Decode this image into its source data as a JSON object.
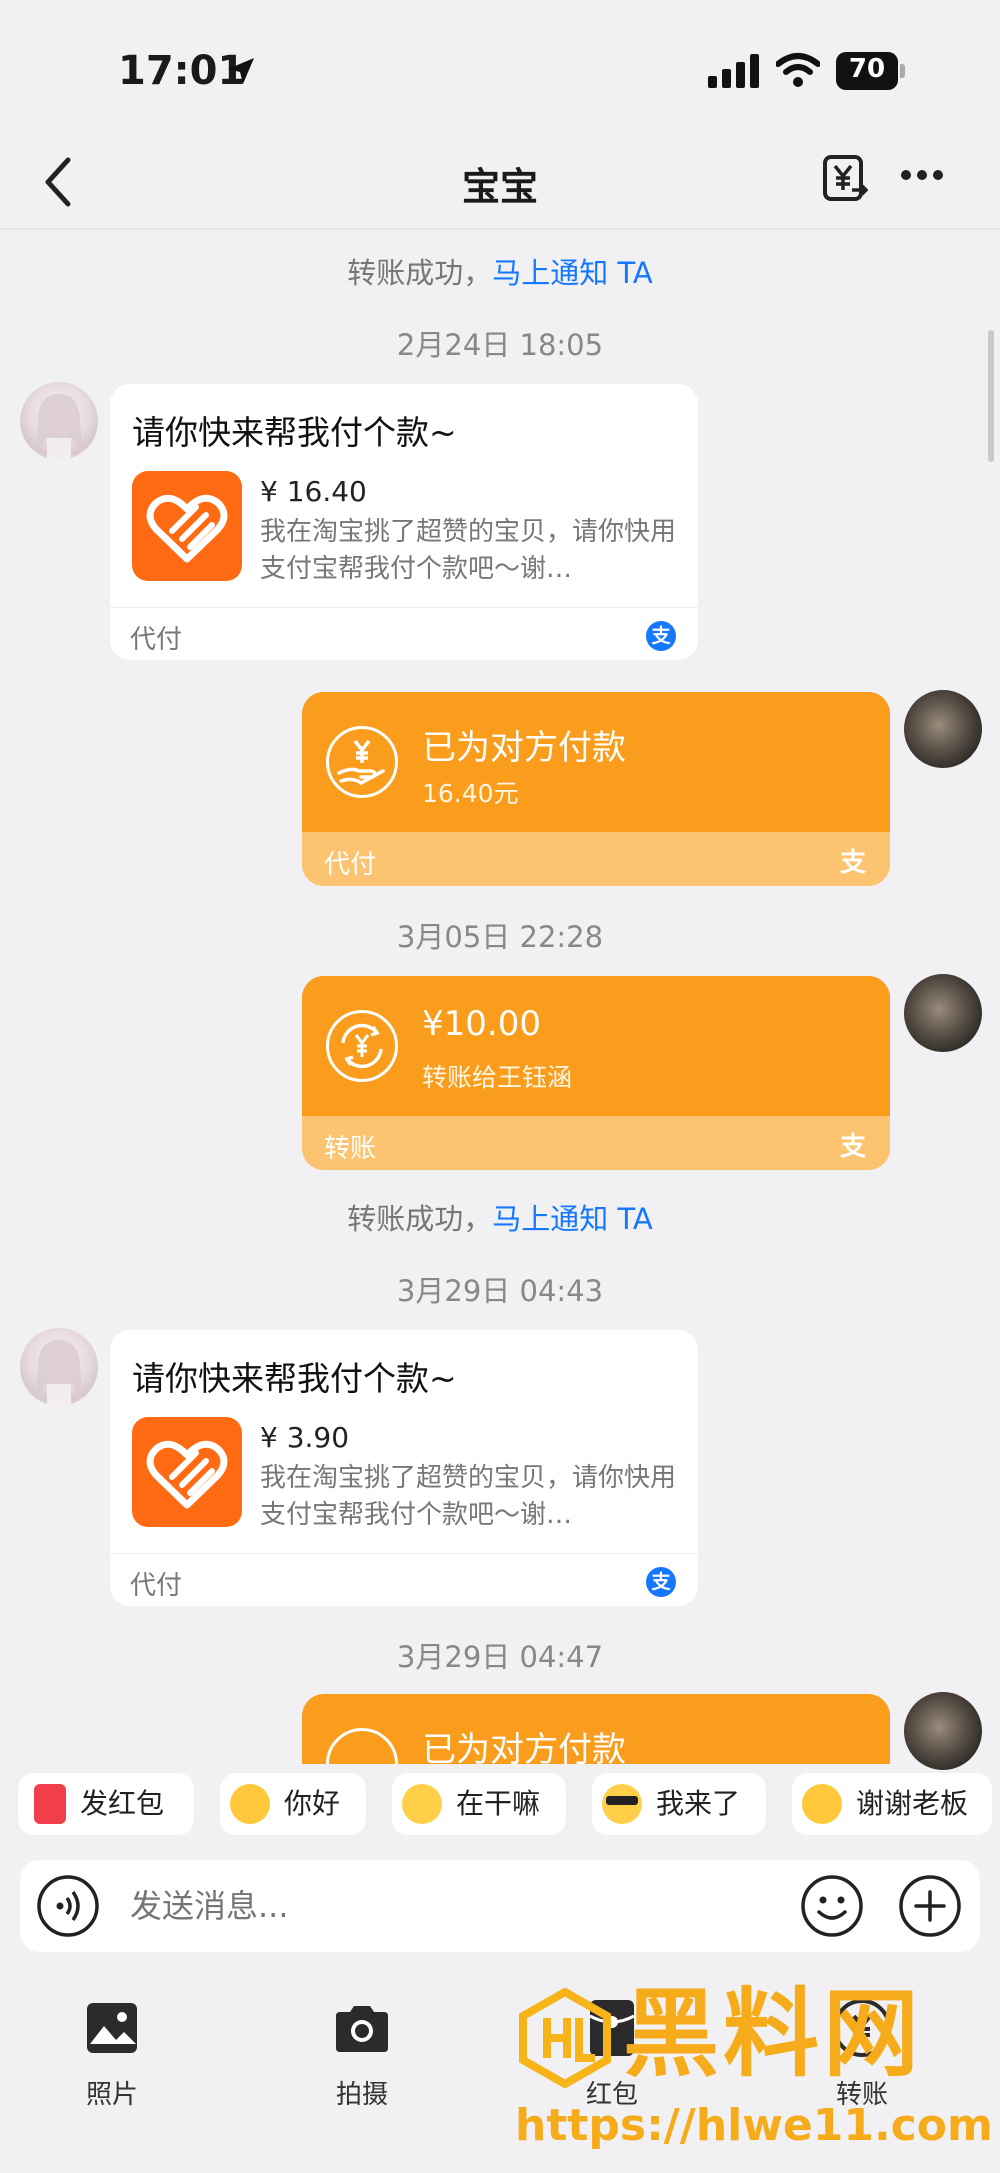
{
  "status_bar": {
    "time": "17:01",
    "battery": "70"
  },
  "nav": {
    "title": "宝宝"
  },
  "messages": {
    "system_1": {
      "text": "转账成功，",
      "link": "马上通知 TA"
    },
    "time_1": "2月24日 18:05",
    "request_1": {
      "title": "请你快来帮我付个款~",
      "price": "¥ 16.40",
      "desc": "我在淘宝挑了超赞的宝贝，请你快用支付宝帮我付个款吧～谢…",
      "footer": "代付"
    },
    "paid_1": {
      "title": "已为对方付款",
      "amount": "16.40元",
      "footer": "代付"
    },
    "time_2": "3月05日 22:28",
    "transfer_1": {
      "title": "¥10.00",
      "sub": "转账给王钰涵",
      "footer": "转账"
    },
    "system_2": {
      "text": "转账成功，",
      "link": "马上通知 TA"
    },
    "time_3": "3月29日 04:43",
    "request_2": {
      "title": "请你快来帮我付个款~",
      "price": "¥ 3.90",
      "desc": "我在淘宝挑了超赞的宝贝，请你快用支付宝帮我付个款吧～谢…",
      "footer": "代付"
    },
    "time_4": "3月29日 04:47",
    "paid_2": {
      "title": "已为对方付款"
    }
  },
  "quick_replies": [
    {
      "label": "发红包",
      "icon": "red-packet-icon"
    },
    {
      "label": "你好",
      "icon": "wave-emoji-icon"
    },
    {
      "label": "在干嘛",
      "icon": "curious-emoji-icon"
    },
    {
      "label": "我来了",
      "icon": "sunglasses-emoji-icon"
    },
    {
      "label": "谢谢老板",
      "icon": "thanks-emoji-icon"
    }
  ],
  "input": {
    "placeholder": "发送消息..."
  },
  "toolbar": [
    {
      "label": "照片",
      "icon": "photo-icon"
    },
    {
      "label": "拍摄",
      "icon": "camera-icon"
    },
    {
      "label": "红包",
      "icon": "red-packet-icon"
    },
    {
      "label": "转账",
      "icon": "transfer-icon"
    }
  ],
  "watermark": {
    "brand": "黑料网",
    "url": "https://hlwe11.com"
  },
  "colors": {
    "orange": "#fa9d1c",
    "link_blue": "#1677ff",
    "orange_icon": "#ff6a13"
  }
}
